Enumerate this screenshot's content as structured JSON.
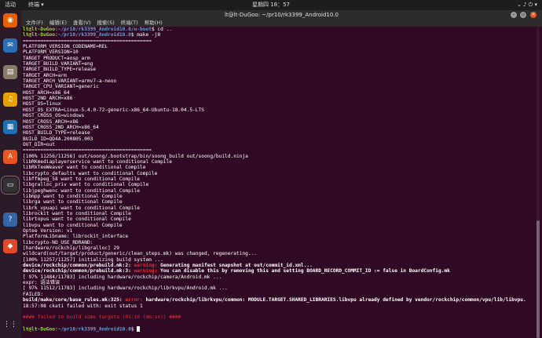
{
  "topbar": {
    "activities": "活动",
    "app": "终端 ▾",
    "clock": "星期四 18：57",
    "tray": "⌄ ♪ ⏻ ▾"
  },
  "window": {
    "title": "lt@lt-DuGoo: ~/pr10/rk3399_Android10.0"
  },
  "menu": [
    "文件(F)",
    "编辑(E)",
    "查看(V)",
    "搜索(S)",
    "终端(T)",
    "帮助(H)"
  ],
  "dock": [
    {
      "name": "firefox-icon",
      "glyph": "◉",
      "color": "#e66000"
    },
    {
      "name": "thunderbird-icon",
      "glyph": "✉",
      "color": "#2a6fb6"
    },
    {
      "name": "files-icon",
      "glyph": "▤",
      "color": "#8a7a68"
    },
    {
      "name": "rhythmbox-icon",
      "glyph": "♫",
      "color": "#e8a000"
    },
    {
      "name": "writer-icon",
      "glyph": "▦",
      "color": "#1f6fb5"
    },
    {
      "name": "software-icon",
      "glyph": "A",
      "color": "#e95420"
    },
    {
      "name": "terminal-icon",
      "glyph": "▭",
      "color": "#333333"
    },
    {
      "name": "help-icon",
      "glyph": "?",
      "color": "#3465a4"
    },
    {
      "name": "app-icon",
      "glyph": "◆",
      "color": "#e04a2a"
    },
    {
      "name": "show-apps-icon",
      "glyph": "⋮⋮",
      "color": "#2b1a28"
    }
  ],
  "terminal": {
    "prompt_user": "lt@lt-DuGoo",
    "prompt_path": "~/pr10/rk3399_Android10.0",
    "lines": [
      [
        {
          "t": "lt@lt-DuGoo",
          "c": "g"
        },
        {
          "t": ":"
        },
        {
          "t": "~/pr10/rk3399_Android10.0/u-boot",
          "c": "b"
        },
        {
          "t": "$ cd .."
        }
      ],
      [
        {
          "t": "lt@lt-DuGoo",
          "c": "g"
        },
        {
          "t": ":"
        },
        {
          "t": "~/pr10/rk3399_Android10.0",
          "c": "b"
        },
        {
          "t": "$ make -j8"
        }
      ],
      [
        {
          "t": "============================================"
        }
      ],
      [
        {
          "t": "PLATFORM_VERSION_CODENAME=REL"
        }
      ],
      [
        {
          "t": "PLATFORM_VERSION=10"
        }
      ],
      [
        {
          "t": "TARGET_PRODUCT=aosp_arm"
        }
      ],
      [
        {
          "t": "TARGET_BUILD_VARIANT=eng"
        }
      ],
      [
        {
          "t": "TARGET_BUILD_TYPE=release"
        }
      ],
      [
        {
          "t": "TARGET_ARCH=arm"
        }
      ],
      [
        {
          "t": "TARGET_ARCH_VARIANT=armv7-a-neon"
        }
      ],
      [
        {
          "t": "TARGET_CPU_VARIANT=generic"
        }
      ],
      [
        {
          "t": "HOST_ARCH=x86_64"
        }
      ],
      [
        {
          "t": "HOST_2ND_ARCH=x86"
        }
      ],
      [
        {
          "t": "HOST_OS=linux"
        }
      ],
      [
        {
          "t": "HOST_OS_EXTRA=Linux-5.4.0-72-generic-x86_64-Ubuntu-18.04.5-LTS"
        }
      ],
      [
        {
          "t": "HOST_CROSS_OS=windows"
        }
      ],
      [
        {
          "t": "HOST_CROSS_ARCH=x86"
        }
      ],
      [
        {
          "t": "HOST_CROSS_2ND_ARCH=x86_64"
        }
      ],
      [
        {
          "t": "HOST_BUILD_TYPE=release"
        }
      ],
      [
        {
          "t": "BUILD_ID=QD4A.200805.003"
        }
      ],
      [
        {
          "t": "OUT_DIR=out"
        }
      ],
      [
        {
          "t": "============================================"
        }
      ],
      [
        {
          "t": "[100% 11256/11256] out/soong/.bootstrap/bin/soong_build out/soong/build.ninja"
        }
      ],
      [
        {
          "t": "libRKmediaplayerservice want to conditional Compile"
        }
      ],
      [
        {
          "t": "libRkTeeWeaver want to conditional Compile"
        }
      ],
      [
        {
          "t": "libcrypto_defaults want to conditional Compile"
        }
      ],
      [
        {
          "t": "libffmpeg_58 want to conditional Compile"
        }
      ],
      [
        {
          "t": "libgralloc_priv want to conditional Compile"
        }
      ],
      [
        {
          "t": "libjpeghwenc want to conditional Compile"
        }
      ],
      [
        {
          "t": "libmpp want to conditional Compile"
        }
      ],
      [
        {
          "t": "librga want to conditional Compile"
        }
      ],
      [
        {
          "t": "librk_vpuapi want to conditional Compile"
        }
      ],
      [
        {
          "t": "librockit want to conditional Compile"
        }
      ],
      [
        {
          "t": "librtopus want to conditional Compile"
        }
      ],
      [
        {
          "t": "libvpu want to conditional Compile"
        }
      ],
      [
        {
          "t": "Optee Version: v1"
        }
      ],
      [
        {
          "t": "PlatformLibname: librockit_interface"
        }
      ],
      [
        {
          "t": "libcrypto-NO_USE_RDRAND:"
        }
      ],
      [
        {
          "t": "[hardware/rockchip/libgralloc] 29"
        }
      ],
      [
        {
          "t": "wildcard(out/target/product/generic/clean_steps.mk) was changed, regenerating..."
        }
      ],
      [
        {
          "t": "[100% 11257/11257] initializing build system ..."
        }
      ],
      [
        {
          "t": "device/rockchip/common/prebuild.mk:2: ",
          "c": "bold"
        },
        {
          "t": "warning: ",
          "c": "m"
        },
        {
          "t": "Generating manifest snapshot at out/commit_id.xml...",
          "c": "bold"
        }
      ],
      [
        {
          "t": "device/rockchip/common/prebuild.mk:3: ",
          "c": "bold"
        },
        {
          "t": "warning: ",
          "c": "m"
        },
        {
          "t": "You can disable this by removing this and setting BOARD_RECORD_COMMIT_ID := false in BoardConfig.mk",
          "c": "bold"
        }
      ],
      [
        {
          "t": "[ 97% 11484/11783] including hardware/rockchip/camera/Android.mk ..."
        }
      ],
      [
        {
          "t": "expr: 语法错误"
        }
      ],
      [
        {
          "t": "[ 97% 11512/11783] including hardware/rockchip/librkvpu/Android.mk ..."
        }
      ],
      [
        {
          "t": "FAILED:"
        }
      ],
      [
        {
          "t": "build/make/core/base_rules.mk:325: ",
          "c": "bold"
        },
        {
          "t": "error: ",
          "c": "m"
        },
        {
          "t": "hardware/rockchip/librkvpu/common: MODULE.TARGET.SHARED_LIBRARIES.libvpu already defined by vendor/rockchip/common/vpu/lib/libvpu.",
          "c": "bold"
        }
      ],
      [
        {
          "t": "18:57:08 ckati failed with: exit status 1"
        }
      ],
      [
        {
          "t": ""
        }
      ],
      [
        {
          "t": "#### failed to build some targets (01:10 (mm:ss)) ####",
          "c": "red"
        }
      ],
      [
        {
          "t": ""
        }
      ],
      [
        {
          "t": "lt@lt-DuGoo",
          "c": "g"
        },
        {
          "t": ":"
        },
        {
          "t": "~/pr10/rk3399_Android10.0",
          "c": "b"
        },
        {
          "t": "$ "
        }
      ]
    ]
  }
}
